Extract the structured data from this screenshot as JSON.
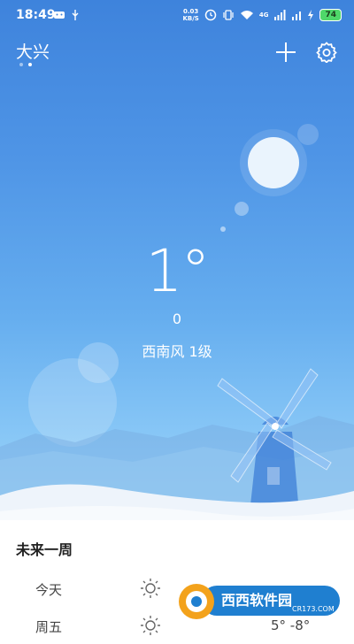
{
  "status_bar": {
    "time": "18:49",
    "net_speed_value": "0.03",
    "net_speed_unit": "KB/S",
    "signal_label": "4G",
    "battery": "74"
  },
  "header": {
    "city": "大兴",
    "page_count": 2,
    "active_page": 1
  },
  "current": {
    "temperature": "1°",
    "condition": "0",
    "wind": "西南风 1级"
  },
  "forecast": {
    "title": "未来一周",
    "days": [
      {
        "day": "今天",
        "icon": "sun-icon",
        "temps": ""
      },
      {
        "day": "周五",
        "icon": "sun-icon",
        "temps": "5° -8°"
      }
    ]
  },
  "watermark": {
    "text": "西西软件园",
    "url": "CR173.COM"
  },
  "colors": {
    "sky_top": "#3e83dc",
    "sky_bottom": "#a9dbfb",
    "battery": "#4fd86a"
  }
}
